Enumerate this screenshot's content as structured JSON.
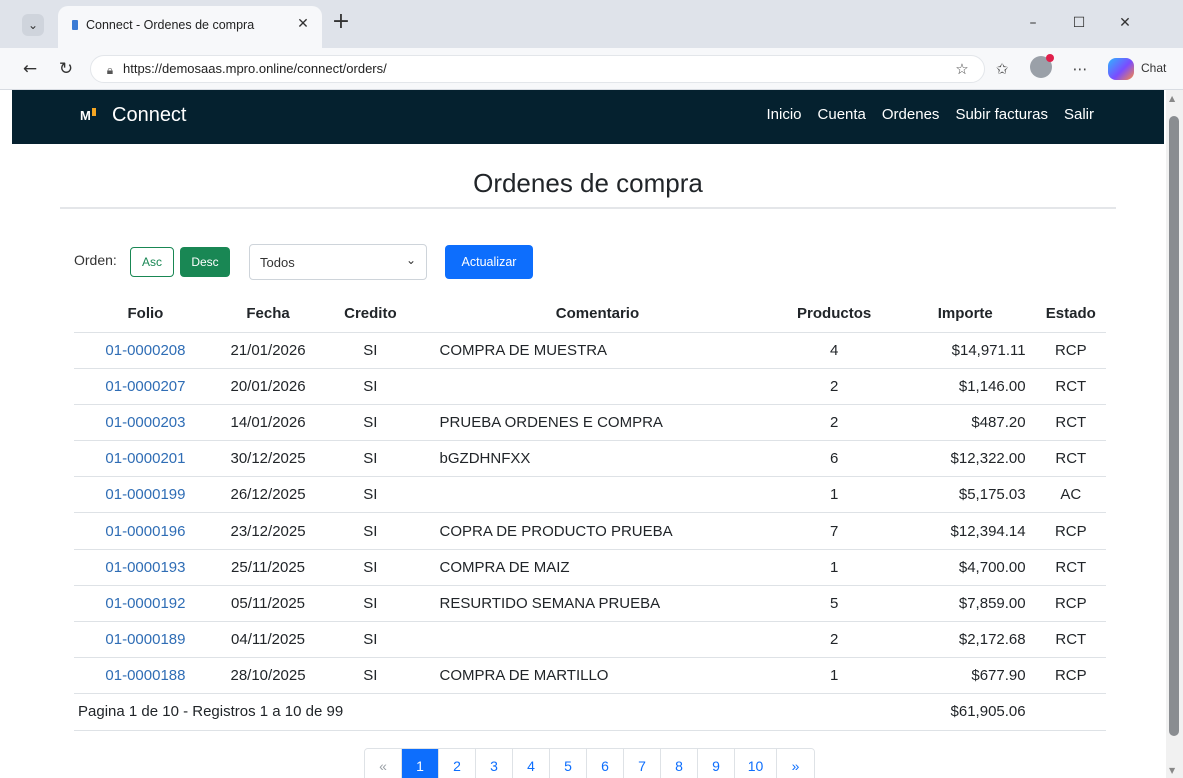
{
  "browser": {
    "tab_title": "Connect - Ordenes de compra",
    "url": "https://demosaas.mpro.online/connect/orders/",
    "chat_label": "Chat"
  },
  "navbar": {
    "logo": "M",
    "brand": "Connect",
    "links": [
      "Inicio",
      "Cuenta",
      "Ordenes",
      "Subir facturas",
      "Salir"
    ]
  },
  "page": {
    "title": "Ordenes de compra"
  },
  "filters": {
    "order_label": "Orden:",
    "asc_label": "Asc",
    "desc_label": "Desc",
    "status_selected": "Todos",
    "update_label": "Actualizar"
  },
  "table": {
    "headers": [
      "Folio",
      "Fecha",
      "Credito",
      "Comentario",
      "Productos",
      "Importe",
      "Estado"
    ],
    "rows": [
      {
        "folio": "01-0000208",
        "fecha": "21/01/2026",
        "credito": "SI",
        "comentario": "COMPRA DE MUESTRA",
        "productos": "4",
        "importe": "$14,971.11",
        "estado": "RCP"
      },
      {
        "folio": "01-0000207",
        "fecha": "20/01/2026",
        "credito": "SI",
        "comentario": "",
        "productos": "2",
        "importe": "$1,146.00",
        "estado": "RCT"
      },
      {
        "folio": "01-0000203",
        "fecha": "14/01/2026",
        "credito": "SI",
        "comentario": "PRUEBA ORDENES E COMPRA",
        "productos": "2",
        "importe": "$487.20",
        "estado": "RCT"
      },
      {
        "folio": "01-0000201",
        "fecha": "30/12/2025",
        "credito": "SI",
        "comentario": "bGZDHNFXX",
        "productos": "6",
        "importe": "$12,322.00",
        "estado": "RCT"
      },
      {
        "folio": "01-0000199",
        "fecha": "26/12/2025",
        "credito": "SI",
        "comentario": "",
        "productos": "1",
        "importe": "$5,175.03",
        "estado": "AC"
      },
      {
        "folio": "01-0000196",
        "fecha": "23/12/2025",
        "credito": "SI",
        "comentario": "COPRA DE PRODUCTO PRUEBA",
        "productos": "7",
        "importe": "$12,394.14",
        "estado": "RCP"
      },
      {
        "folio": "01-0000193",
        "fecha": "25/11/2025",
        "credito": "SI",
        "comentario": "COMPRA DE MAIZ",
        "productos": "1",
        "importe": "$4,700.00",
        "estado": "RCT"
      },
      {
        "folio": "01-0000192",
        "fecha": "05/11/2025",
        "credito": "SI",
        "comentario": "RESURTIDO SEMANA PRUEBA",
        "productos": "5",
        "importe": "$7,859.00",
        "estado": "RCP"
      },
      {
        "folio": "01-0000189",
        "fecha": "04/11/2025",
        "credito": "SI",
        "comentario": "",
        "productos": "2",
        "importe": "$2,172.68",
        "estado": "RCT"
      },
      {
        "folio": "01-0000188",
        "fecha": "28/10/2025",
        "credito": "SI",
        "comentario": "COMPRA DE MARTILLO",
        "productos": "1",
        "importe": "$677.90",
        "estado": "RCP"
      }
    ],
    "footer": {
      "summary": "Pagina 1 de 10 - Registros 1 a 10 de 99",
      "total": "$61,905.06"
    }
  },
  "pagination": {
    "prev": "«",
    "pages": [
      "1",
      "2",
      "3",
      "4",
      "5",
      "6",
      "7",
      "8",
      "9",
      "10"
    ],
    "next": "»",
    "current": "1"
  },
  "colors": {
    "navbar_bg": "#05212f",
    "success": "#198754",
    "primary": "#0d6efd",
    "link": "#2f6db5"
  }
}
